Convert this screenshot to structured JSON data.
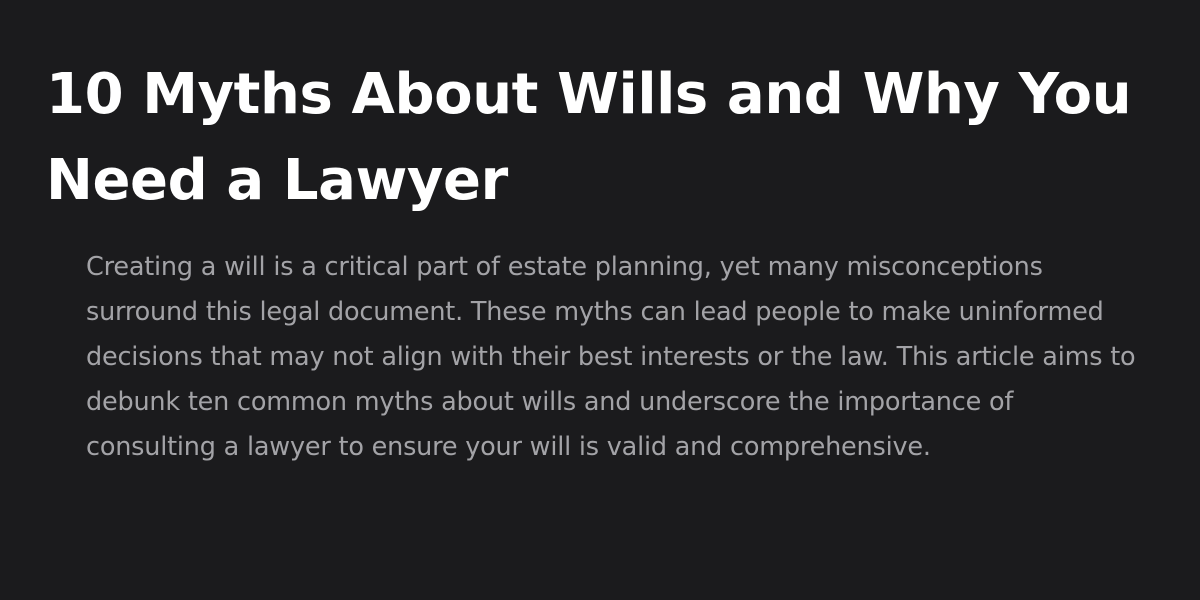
{
  "article": {
    "title": "10 Myths About Wills and Why You Need a Lawyer",
    "intro": "Creating a will is a critical part of estate planning, yet many misconceptions surround this legal document. These myths can lead people to make uninformed decisions that may not align with their best interests or the law. This article aims to debunk ten common myths about wills and underscore the importance of consulting a lawyer to ensure your will is valid and comprehensive."
  },
  "colors": {
    "background": "#1b1b1d",
    "title": "#ffffff",
    "body_text": "#a3a3a7"
  }
}
